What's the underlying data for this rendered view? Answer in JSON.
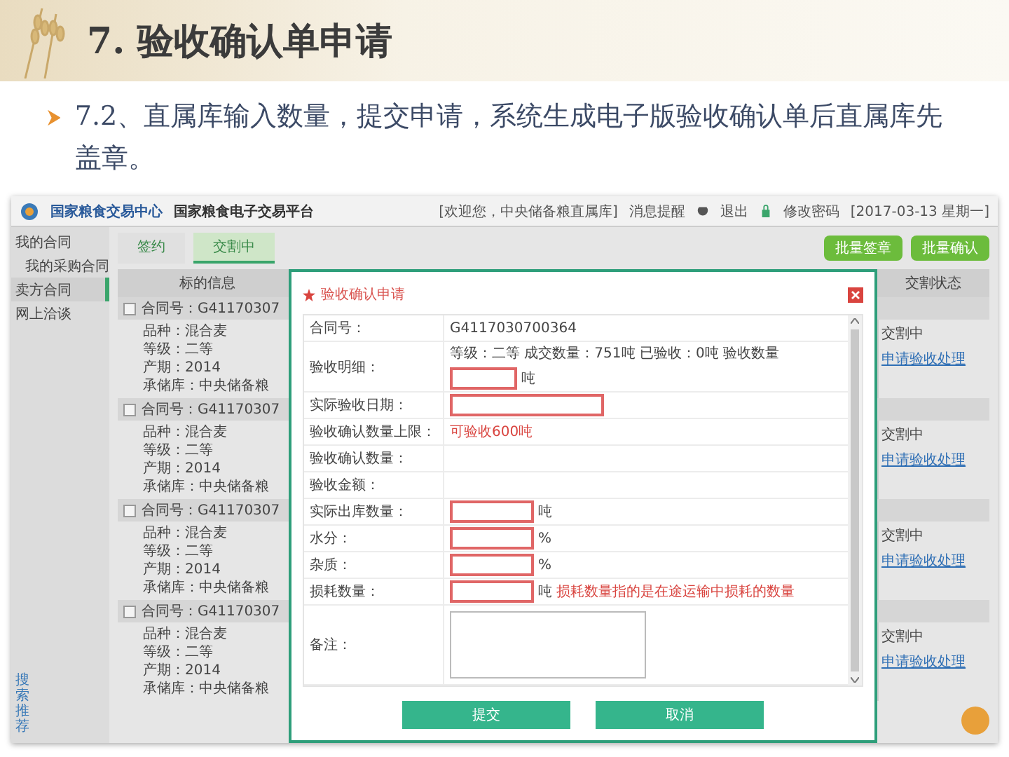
{
  "slide": {
    "title": "7. 验收确认单申请",
    "bullet": "7.2、直属库输入数量，提交申请，系统生成电子版验收确认单后直属库先盖章。"
  },
  "app": {
    "logo_text": "国家粮食交易中心",
    "platform": "国家粮食电子交易平台",
    "welcome": "[欢迎您，中央储备粮直属库]",
    "messages": "消息提醒",
    "logout": "退出",
    "change_password": "修改密码",
    "date": "[2017-03-13 星期一]"
  },
  "sidebar": {
    "items": [
      {
        "label": "我的合同",
        "selected": false,
        "children": [
          {
            "label": "我的采购合同",
            "selected": false
          }
        ]
      },
      {
        "label": "卖方合同",
        "selected": true
      },
      {
        "label": "网上洽谈",
        "selected": false
      }
    ],
    "side_tab": "搜索推荐"
  },
  "tabs": [
    {
      "label": "签约",
      "selected": false
    },
    {
      "label": "交割中",
      "selected": true
    }
  ],
  "toolbar_buttons": [
    "批量签章",
    "批量确认"
  ],
  "table": {
    "columns": [
      "标的信息",
      "交割状态"
    ],
    "groups": [
      {
        "checked": false,
        "contract": "合同号：G41170307",
        "lines": [
          "品种：混合麦",
          "等级：二等",
          "产期：2014",
          "承储库：中央储备粮"
        ],
        "status": "交割中",
        "action": "申请验收处理"
      },
      {
        "checked": false,
        "contract": "合同号：G41170307",
        "lines": [
          "品种：混合麦",
          "等级：二等",
          "产期：2014",
          "承储库：中央储备粮"
        ],
        "status": "交割中",
        "action": "申请验收处理"
      },
      {
        "checked": false,
        "contract": "合同号：G41170307",
        "lines": [
          "品种：混合麦",
          "等级：二等",
          "产期：2014",
          "承储库：中央储备粮"
        ],
        "status": "交割中",
        "action": "申请验收处理"
      },
      {
        "checked": false,
        "contract": "合同号：G41170307",
        "lines": [
          "品种：混合麦",
          "等级：二等",
          "产期：2014",
          "承储库：中央储备粮"
        ],
        "status": "交割中",
        "action": "申请验收处理"
      }
    ]
  },
  "modal": {
    "title": "验收确认申请",
    "rows": [
      {
        "kind": "text",
        "label": "合同号：",
        "value": "G4117030700364"
      },
      {
        "kind": "detail",
        "label": "验收明细：",
        "value": "等级：二等 成交数量：751吨 已验收：0吨 验收数量",
        "unit": "吨"
      },
      {
        "kind": "input",
        "label": "实际验收日期："
      },
      {
        "kind": "note",
        "label": "验收确认数量上限：",
        "value": "可验收600吨"
      },
      {
        "kind": "text",
        "label": "验收确认数量："
      },
      {
        "kind": "text",
        "label": "验收金额："
      },
      {
        "kind": "unit_input",
        "label": "实际出库数量：",
        "unit": "吨"
      },
      {
        "kind": "unit_input",
        "label": "水分：",
        "unit": "%"
      },
      {
        "kind": "unit_input",
        "label": "杂质：",
        "unit": "%"
      },
      {
        "kind": "unit_input",
        "label": "损耗数量：",
        "unit": "吨",
        "note": "损耗数量指的是在途运输中损耗的数量"
      },
      {
        "kind": "textarea",
        "label": "备注："
      }
    ],
    "buttons": [
      "提交",
      "取消"
    ]
  }
}
